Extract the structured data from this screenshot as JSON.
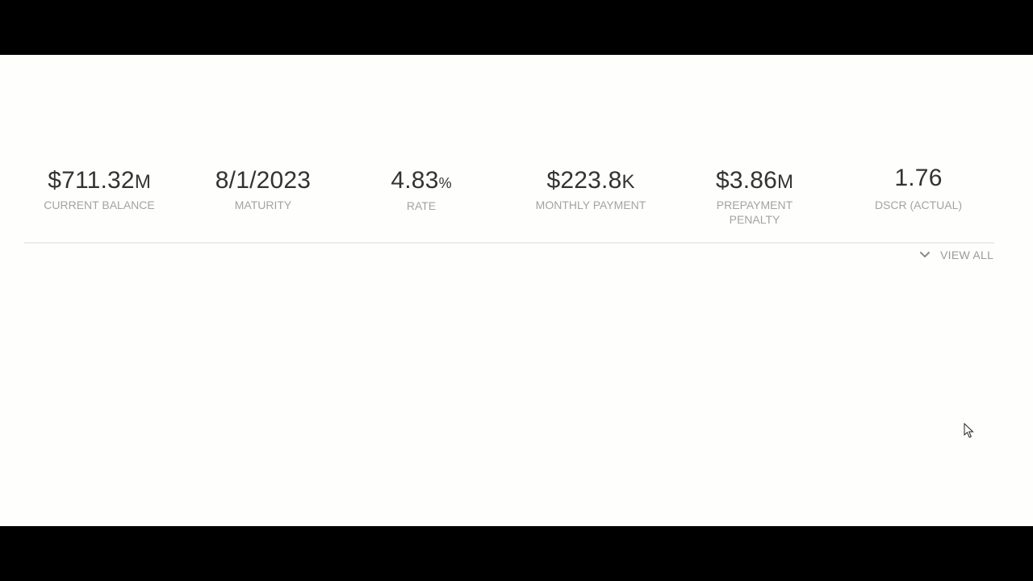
{
  "stats": [
    {
      "value": "$711.32",
      "unit": "M",
      "label": "CURRENT BALANCE"
    },
    {
      "value": "8/1/2023",
      "unit": "",
      "label": "MATURITY"
    },
    {
      "value": "4.83",
      "unit": "%",
      "label": "RATE"
    },
    {
      "value": "$223.8",
      "unit": "K",
      "label": "MONTHLY PAYMENT"
    },
    {
      "value": "$3.86",
      "unit": "M",
      "label": "PREPAYMENT PENALTY"
    },
    {
      "value": "1.76",
      "unit": "",
      "label": "DSCR (ACTUAL)"
    }
  ],
  "view_all": {
    "label": "VIEW ALL",
    "icon": "chevron-down-icon"
  },
  "colors": {
    "value_text": "#333333",
    "label_text": "#a3a3a3",
    "divider": "#ececec",
    "letterbox": "#000000",
    "background": "#fefefd"
  }
}
